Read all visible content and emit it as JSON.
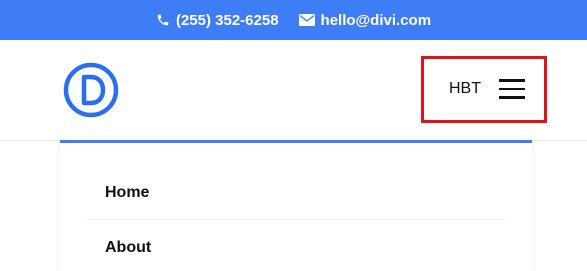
{
  "topbar": {
    "phone": "(255) 352-6258",
    "phone_icon": "phone-icon",
    "email": "hello@divi.com",
    "email_icon": "envelope-icon",
    "background": "#3f7df6"
  },
  "header": {
    "logo_letter": "D",
    "logo_color": "#2c6ef2",
    "menu_label": "HBT",
    "menu_icon": "hamburger-menu-icon",
    "highlight_color": "#e0121c"
  },
  "menu": {
    "accent": "#3f7df6",
    "items": [
      {
        "label": "Home"
      },
      {
        "label": "About"
      }
    ]
  }
}
